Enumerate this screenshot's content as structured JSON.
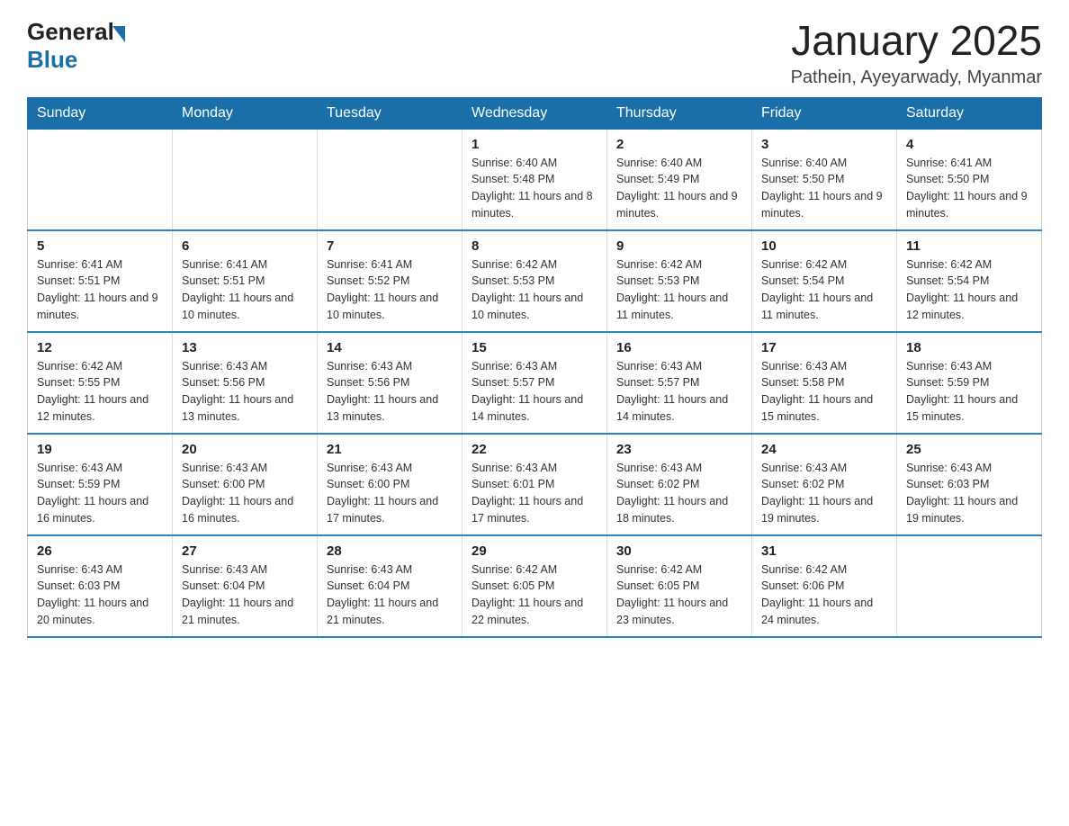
{
  "header": {
    "logo_general": "General",
    "logo_blue": "Blue",
    "month_title": "January 2025",
    "location": "Pathein, Ayeyarwady, Myanmar"
  },
  "days_of_week": [
    "Sunday",
    "Monday",
    "Tuesday",
    "Wednesday",
    "Thursday",
    "Friday",
    "Saturday"
  ],
  "weeks": [
    [
      {
        "day": "",
        "info": ""
      },
      {
        "day": "",
        "info": ""
      },
      {
        "day": "",
        "info": ""
      },
      {
        "day": "1",
        "info": "Sunrise: 6:40 AM\nSunset: 5:48 PM\nDaylight: 11 hours and 8 minutes."
      },
      {
        "day": "2",
        "info": "Sunrise: 6:40 AM\nSunset: 5:49 PM\nDaylight: 11 hours and 9 minutes."
      },
      {
        "day": "3",
        "info": "Sunrise: 6:40 AM\nSunset: 5:50 PM\nDaylight: 11 hours and 9 minutes."
      },
      {
        "day": "4",
        "info": "Sunrise: 6:41 AM\nSunset: 5:50 PM\nDaylight: 11 hours and 9 minutes."
      }
    ],
    [
      {
        "day": "5",
        "info": "Sunrise: 6:41 AM\nSunset: 5:51 PM\nDaylight: 11 hours and 9 minutes."
      },
      {
        "day": "6",
        "info": "Sunrise: 6:41 AM\nSunset: 5:51 PM\nDaylight: 11 hours and 10 minutes."
      },
      {
        "day": "7",
        "info": "Sunrise: 6:41 AM\nSunset: 5:52 PM\nDaylight: 11 hours and 10 minutes."
      },
      {
        "day": "8",
        "info": "Sunrise: 6:42 AM\nSunset: 5:53 PM\nDaylight: 11 hours and 10 minutes."
      },
      {
        "day": "9",
        "info": "Sunrise: 6:42 AM\nSunset: 5:53 PM\nDaylight: 11 hours and 11 minutes."
      },
      {
        "day": "10",
        "info": "Sunrise: 6:42 AM\nSunset: 5:54 PM\nDaylight: 11 hours and 11 minutes."
      },
      {
        "day": "11",
        "info": "Sunrise: 6:42 AM\nSunset: 5:54 PM\nDaylight: 11 hours and 12 minutes."
      }
    ],
    [
      {
        "day": "12",
        "info": "Sunrise: 6:42 AM\nSunset: 5:55 PM\nDaylight: 11 hours and 12 minutes."
      },
      {
        "day": "13",
        "info": "Sunrise: 6:43 AM\nSunset: 5:56 PM\nDaylight: 11 hours and 13 minutes."
      },
      {
        "day": "14",
        "info": "Sunrise: 6:43 AM\nSunset: 5:56 PM\nDaylight: 11 hours and 13 minutes."
      },
      {
        "day": "15",
        "info": "Sunrise: 6:43 AM\nSunset: 5:57 PM\nDaylight: 11 hours and 14 minutes."
      },
      {
        "day": "16",
        "info": "Sunrise: 6:43 AM\nSunset: 5:57 PM\nDaylight: 11 hours and 14 minutes."
      },
      {
        "day": "17",
        "info": "Sunrise: 6:43 AM\nSunset: 5:58 PM\nDaylight: 11 hours and 15 minutes."
      },
      {
        "day": "18",
        "info": "Sunrise: 6:43 AM\nSunset: 5:59 PM\nDaylight: 11 hours and 15 minutes."
      }
    ],
    [
      {
        "day": "19",
        "info": "Sunrise: 6:43 AM\nSunset: 5:59 PM\nDaylight: 11 hours and 16 minutes."
      },
      {
        "day": "20",
        "info": "Sunrise: 6:43 AM\nSunset: 6:00 PM\nDaylight: 11 hours and 16 minutes."
      },
      {
        "day": "21",
        "info": "Sunrise: 6:43 AM\nSunset: 6:00 PM\nDaylight: 11 hours and 17 minutes."
      },
      {
        "day": "22",
        "info": "Sunrise: 6:43 AM\nSunset: 6:01 PM\nDaylight: 11 hours and 17 minutes."
      },
      {
        "day": "23",
        "info": "Sunrise: 6:43 AM\nSunset: 6:02 PM\nDaylight: 11 hours and 18 minutes."
      },
      {
        "day": "24",
        "info": "Sunrise: 6:43 AM\nSunset: 6:02 PM\nDaylight: 11 hours and 19 minutes."
      },
      {
        "day": "25",
        "info": "Sunrise: 6:43 AM\nSunset: 6:03 PM\nDaylight: 11 hours and 19 minutes."
      }
    ],
    [
      {
        "day": "26",
        "info": "Sunrise: 6:43 AM\nSunset: 6:03 PM\nDaylight: 11 hours and 20 minutes."
      },
      {
        "day": "27",
        "info": "Sunrise: 6:43 AM\nSunset: 6:04 PM\nDaylight: 11 hours and 21 minutes."
      },
      {
        "day": "28",
        "info": "Sunrise: 6:43 AM\nSunset: 6:04 PM\nDaylight: 11 hours and 21 minutes."
      },
      {
        "day": "29",
        "info": "Sunrise: 6:42 AM\nSunset: 6:05 PM\nDaylight: 11 hours and 22 minutes."
      },
      {
        "day": "30",
        "info": "Sunrise: 6:42 AM\nSunset: 6:05 PM\nDaylight: 11 hours and 23 minutes."
      },
      {
        "day": "31",
        "info": "Sunrise: 6:42 AM\nSunset: 6:06 PM\nDaylight: 11 hours and 24 minutes."
      },
      {
        "day": "",
        "info": ""
      }
    ]
  ]
}
